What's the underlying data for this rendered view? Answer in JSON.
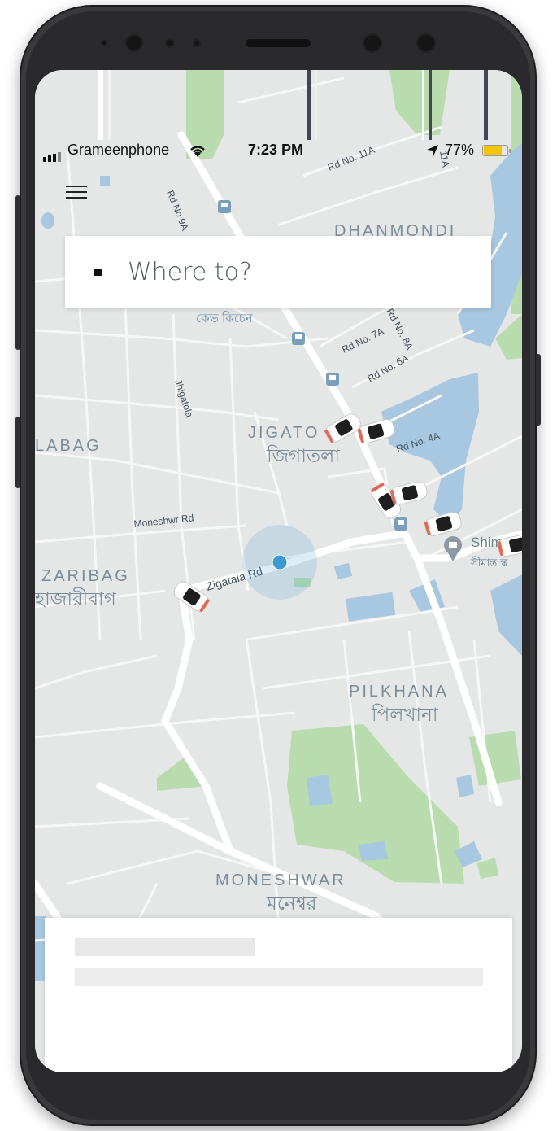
{
  "status_bar": {
    "carrier": "Grameenphone",
    "time": "7:23 PM",
    "battery": "77%"
  },
  "search": {
    "placeholder": "Where to?"
  },
  "map": {
    "areas": [
      {
        "name": "DHANMONDI"
      },
      {
        "name": "JIGATOLA",
        "display": "JIGATO"
      },
      {
        "name_bn": "জিগাতলা"
      },
      {
        "name": "LALBAG",
        "display": "LABAG"
      },
      {
        "name": "ZARIBAG",
        "display": "ZARIBAG"
      },
      {
        "name_bn": "হাজারীবাগ",
        "display": "হাজারীবাগ"
      },
      {
        "name": "PILKHANA"
      },
      {
        "name_bn": "পিলখানা"
      },
      {
        "name": "MONESHWAR"
      },
      {
        "name_bn": "মনেশ্বর"
      }
    ],
    "roads": [
      "Rd No 9A",
      "Rd No. 11A",
      "Rd No. 7A",
      "Rd No. 8A",
      "Rd No. 6A",
      "Rd No. 4A",
      "Jhigatola",
      "Moneshwr Rd",
      "Zigatala Rd"
    ],
    "places": [
      "কেভ কিচেন",
      "Shim",
      "সীমান্ত স্ক"
    ],
    "car_count": 7,
    "icons": [
      "bus-stop-icon",
      "car-icon",
      "user-location-icon",
      "shop-pin-icon"
    ]
  },
  "colors": {
    "map_bg": "#e5e6e6",
    "road": "#ffffff",
    "water": "#a8c7e0",
    "park": "#b8dcae",
    "accent_location": "#3d9ad1"
  }
}
